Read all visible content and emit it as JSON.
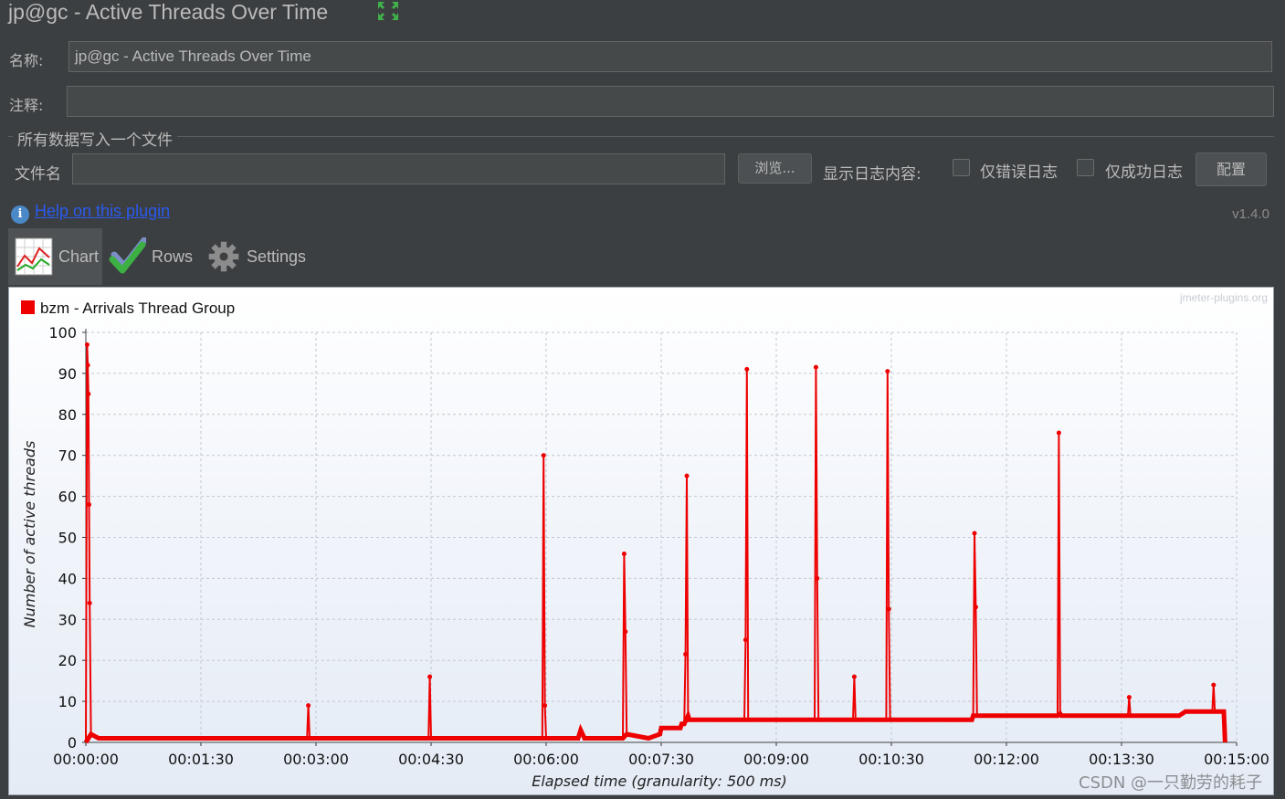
{
  "window": {
    "title": "jp@gc - Active Threads Over Time"
  },
  "form": {
    "name_label": "名称:",
    "name_value": "jp@gc - Active Threads Over Time",
    "comment_label": "注释:",
    "comment_value": "",
    "file_section_title": "所有数据写入一个文件",
    "filename_label": "文件名",
    "filename_value": "",
    "browse_label": "浏览...",
    "log_content_label": "显示日志内容:",
    "errors_only_label": "仅错误日志",
    "success_only_label": "仅成功日志",
    "configure_label": "配置"
  },
  "plugin": {
    "help_link": "Help on this plugin",
    "version": "v1.4.0"
  },
  "tabs": [
    {
      "label": "Chart",
      "icon": "chart-icon",
      "active": true
    },
    {
      "label": "Rows",
      "icon": "checkmark-icon",
      "active": false
    },
    {
      "label": "Settings",
      "icon": "gear-icon",
      "active": false
    }
  ],
  "chart_watermark": "jmeter-plugins.org",
  "page_watermark": "CSDN @一只勤劳的耗子",
  "chart_data": {
    "type": "line",
    "series": [
      {
        "name": "bzm - Arrivals Thread Group",
        "color": "#ee0000",
        "points": [
          [
            0,
            0
          ],
          [
            1,
            97
          ],
          [
            1.5,
            92
          ],
          [
            2,
            85
          ],
          [
            2.5,
            58
          ],
          [
            3,
            34
          ],
          [
            4,
            2
          ],
          [
            10,
            1
          ],
          [
            60,
            1
          ],
          [
            120,
            1
          ],
          [
            170,
            1
          ],
          [
            173,
            1
          ],
          [
            174,
            9
          ],
          [
            175,
            1
          ],
          [
            250,
            1
          ],
          [
            268,
            1
          ],
          [
            269,
            16
          ],
          [
            270,
            1
          ],
          [
            330,
            1
          ],
          [
            357,
            1
          ],
          [
            358,
            70
          ],
          [
            359,
            9
          ],
          [
            360,
            1
          ],
          [
            385,
            1
          ],
          [
            387,
            3
          ],
          [
            390,
            1
          ],
          [
            420,
            1
          ],
          [
            421,
            46
          ],
          [
            422,
            27
          ],
          [
            423,
            2
          ],
          [
            440,
            1
          ],
          [
            449,
            2
          ],
          [
            450,
            3.5
          ],
          [
            465,
            3.5
          ],
          [
            466,
            4.5
          ],
          [
            468,
            4.5
          ],
          [
            469,
            21.5
          ],
          [
            470,
            65
          ],
          [
            471,
            6.5
          ],
          [
            472,
            5.5
          ],
          [
            485,
            5.5
          ],
          [
            515,
            5.5
          ],
          [
            516,
            25
          ],
          [
            517,
            91
          ],
          [
            518,
            5.5
          ],
          [
            570,
            5.5
          ],
          [
            571,
            91.5
          ],
          [
            572,
            40
          ],
          [
            573,
            5.5
          ],
          [
            600,
            5.5
          ],
          [
            601,
            16
          ],
          [
            602,
            5.5
          ],
          [
            626,
            5.5
          ],
          [
            627,
            90.5
          ],
          [
            628,
            32.5
          ],
          [
            629,
            5.5
          ],
          [
            650,
            5.5
          ],
          [
            693,
            5.5
          ],
          [
            694,
            6.5
          ],
          [
            695,
            51
          ],
          [
            696,
            33
          ],
          [
            697,
            6.5
          ],
          [
            760,
            6.5
          ],
          [
            761,
            75.5
          ],
          [
            762,
            7
          ],
          [
            763,
            6.5
          ],
          [
            815,
            6.5
          ],
          [
            816,
            11
          ],
          [
            817,
            6.5
          ],
          [
            855,
            6.5
          ],
          [
            860,
            7.5
          ],
          [
            870,
            7.5
          ],
          [
            881,
            7.5
          ],
          [
            882,
            14
          ],
          [
            883,
            7.5
          ],
          [
            890,
            7.5
          ],
          [
            891,
            0
          ]
        ]
      }
    ],
    "xlabel": "Elapsed time (granularity: 500 ms)",
    "ylabel": "Number of active threads",
    "xlim": [
      0,
      900
    ],
    "ylim": [
      0,
      100
    ],
    "x_ticks": [
      {
        "value": 0,
        "label": "00:00:00"
      },
      {
        "value": 90,
        "label": "00:01:30"
      },
      {
        "value": 180,
        "label": "00:03:00"
      },
      {
        "value": 270,
        "label": "00:04:30"
      },
      {
        "value": 360,
        "label": "00:06:00"
      },
      {
        "value": 450,
        "label": "00:07:30"
      },
      {
        "value": 540,
        "label": "00:09:00"
      },
      {
        "value": 630,
        "label": "00:10:30"
      },
      {
        "value": 720,
        "label": "00:12:00"
      },
      {
        "value": 810,
        "label": "00:13:30"
      },
      {
        "value": 900,
        "label": "00:15:00"
      }
    ],
    "y_ticks": [
      0,
      10,
      20,
      30,
      40,
      50,
      60,
      70,
      80,
      90,
      100
    ],
    "grid": true,
    "legend_position": "top-left"
  }
}
